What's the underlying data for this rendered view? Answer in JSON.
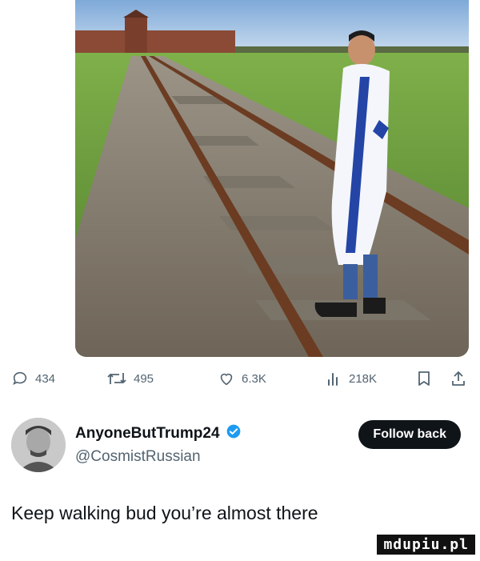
{
  "post": {
    "image_alt": "Man draped in an Israeli flag standing on railway tracks leading to a brick gatehouse",
    "text": "Keep walking bud you’re almost there"
  },
  "actions": {
    "replies": "434",
    "reposts": "495",
    "likes": "6.3K",
    "views": "218K"
  },
  "author": {
    "display_name": "AnyoneButTrump24",
    "handle": "@CosmistRussian",
    "verified": true,
    "follow_label": "Follow back"
  },
  "watermark": "mdupiu.pl",
  "colors": {
    "text_primary": "#0f1419",
    "text_secondary": "#536471",
    "verified_badge": "#1d9bf0",
    "follow_button": "#0f1419"
  }
}
